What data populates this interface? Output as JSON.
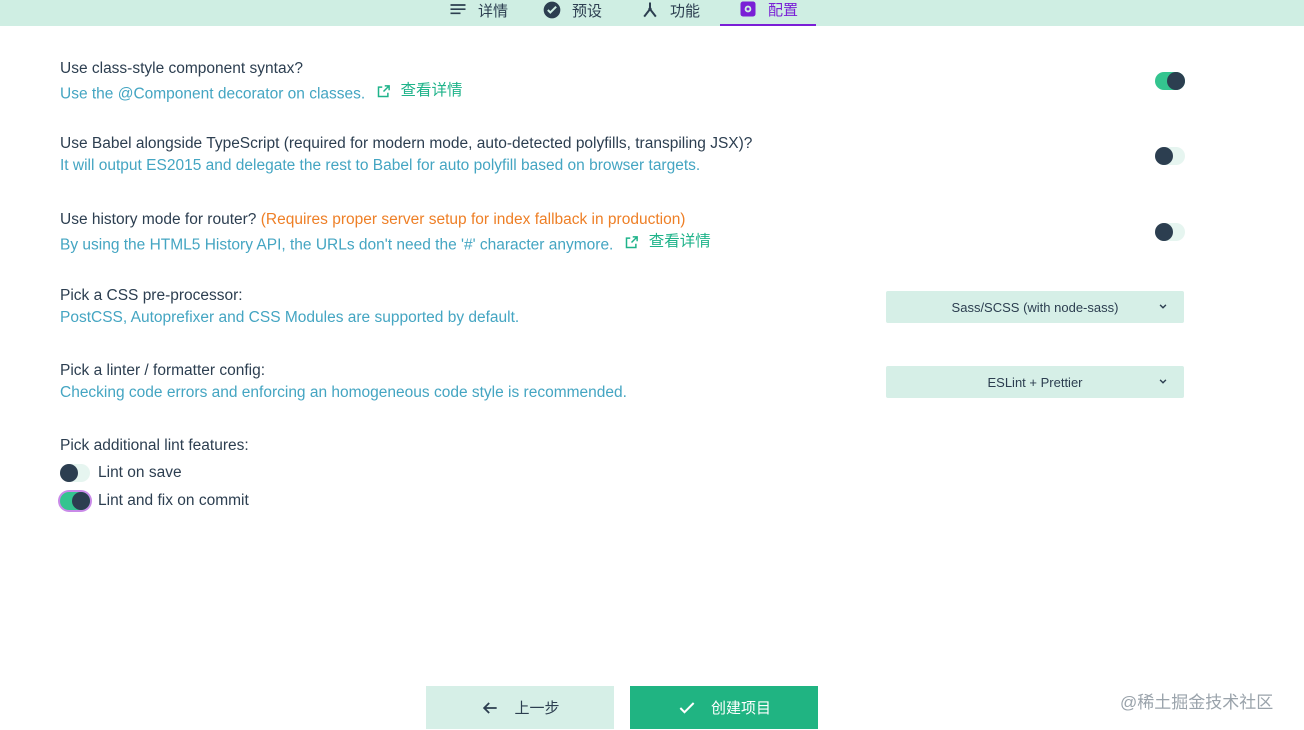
{
  "tabs": [
    {
      "label": "详情",
      "icon": "list-icon"
    },
    {
      "label": "预设",
      "icon": "check-circle-icon"
    },
    {
      "label": "功能",
      "icon": "fork-icon"
    },
    {
      "label": "配置",
      "icon": "settings-icon"
    }
  ],
  "options": {
    "class_component": {
      "title": "Use class-style component syntax?",
      "desc": "Use the @Component decorator on classes.",
      "link": "查看详情",
      "enabled": true
    },
    "babel": {
      "title": "Use Babel alongside TypeScript (required for modern mode, auto-detected polyfills, transpiling JSX)?",
      "desc": "It will output ES2015 and delegate the rest to Babel for auto polyfill based on browser targets.",
      "enabled": false
    },
    "history": {
      "title": "Use history mode for router?",
      "warning": "(Requires proper server setup for index fallback in production)",
      "desc": "By using the HTML5 History API, the URLs don't need the '#' character anymore.",
      "link": "查看详情",
      "enabled": false
    },
    "css": {
      "title": "Pick a CSS pre-processor:",
      "desc": "PostCSS, Autoprefixer and CSS Modules are supported by default.",
      "selected": "Sass/SCSS (with node-sass)"
    },
    "linter": {
      "title": "Pick a linter / formatter config:",
      "desc": "Checking code errors and enforcing an homogeneous code style is recommended.",
      "selected": "ESLint + Prettier"
    },
    "lint_features": {
      "title": "Pick additional lint features:",
      "items": [
        {
          "label": "Lint on save",
          "enabled": false
        },
        {
          "label": "Lint and fix on commit",
          "enabled": true
        }
      ]
    }
  },
  "buttons": {
    "back": "上一步",
    "create": "创建项目"
  },
  "watermark": "@稀土掘金技术社区",
  "colors": {
    "accent": "#20b482",
    "active_tab": "#7a1fd6",
    "warning": "#ee7f26",
    "desc": "#44a5c2"
  }
}
